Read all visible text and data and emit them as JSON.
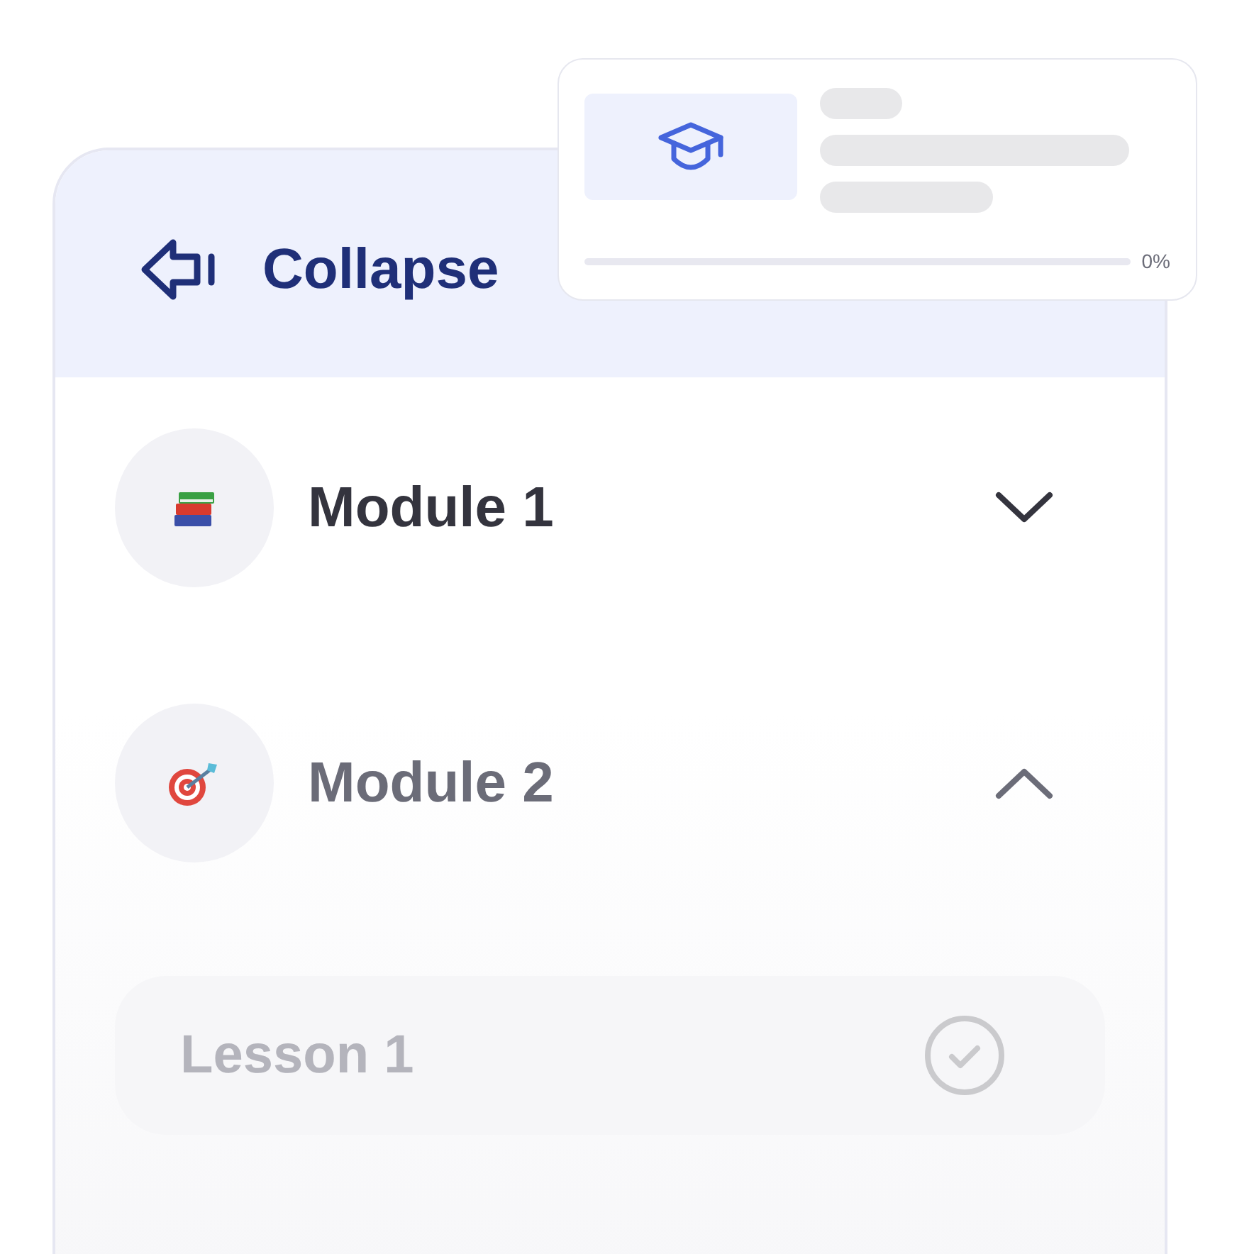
{
  "header": {
    "label": "Collapse"
  },
  "modules": [
    {
      "title": "Module 1",
      "expanded": false
    },
    {
      "title": "Module 2",
      "expanded": true,
      "lessons": [
        {
          "title": "Lesson 1",
          "completed": true
        }
      ]
    }
  ],
  "course_card": {
    "progress": {
      "level": 0,
      "reading": "0%"
    }
  }
}
